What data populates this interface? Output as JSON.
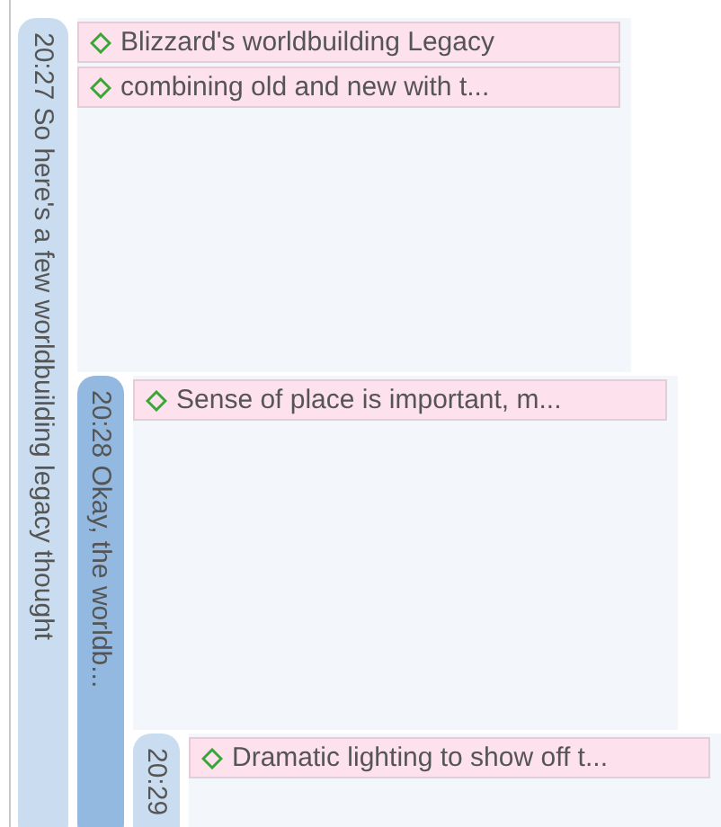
{
  "groups": [
    {
      "label": "20:27 So here's a few worldbuilding legacy thought",
      "selected": false,
      "items": [
        "Blizzard's worldbuilding Legacy",
        "combining old and new with t..."
      ],
      "children": [
        {
          "label": "20:28 Okay, the worldb...",
          "selected": true,
          "items": [
            "Sense of place is important, m..."
          ],
          "children": [
            {
              "label": "20:29",
              "selected": false,
              "items": [
                "Dramatic lighting to show off t..."
              ]
            }
          ]
        }
      ]
    }
  ]
}
